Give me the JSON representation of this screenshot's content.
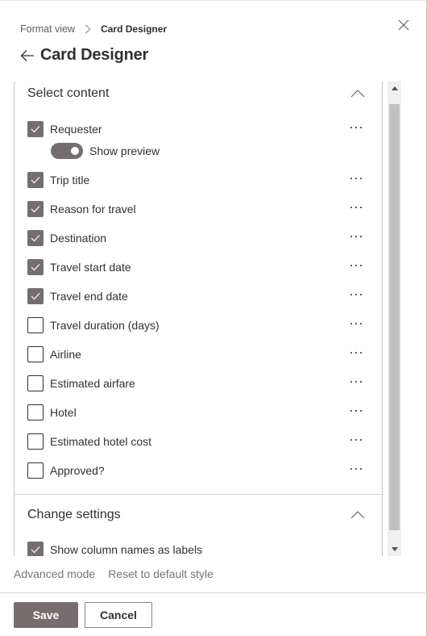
{
  "breadcrumb": {
    "parent": "Format view",
    "current": "Card Designer"
  },
  "header": {
    "title": "Card Designer",
    "back_icon": "arrow-left-icon",
    "close_icon": "close-icon"
  },
  "sections": {
    "select_content": {
      "title": "Select content",
      "expanded": true,
      "items": [
        {
          "label": "Requester",
          "checked": true
        },
        {
          "label": "Trip title",
          "checked": true
        },
        {
          "label": "Reason for travel",
          "checked": true
        },
        {
          "label": "Destination",
          "checked": true
        },
        {
          "label": "Travel start date",
          "checked": true
        },
        {
          "label": "Travel end date",
          "checked": true
        },
        {
          "label": "Travel duration (days)",
          "checked": false
        },
        {
          "label": "Airline",
          "checked": false
        },
        {
          "label": "Estimated airfare",
          "checked": false
        },
        {
          "label": "Hotel",
          "checked": false
        },
        {
          "label": "Estimated hotel cost",
          "checked": false
        },
        {
          "label": "Approved?",
          "checked": false
        }
      ],
      "preview_toggle": {
        "label": "Show preview",
        "on": true
      }
    },
    "change_settings": {
      "title": "Change settings",
      "expanded": true,
      "items": [
        {
          "label": "Show column names as labels",
          "checked": true
        }
      ]
    }
  },
  "footer": {
    "links": [
      "Advanced mode",
      "Reset to default style"
    ],
    "save_label": "Save",
    "cancel_label": "Cancel"
  },
  "colors": {
    "accent": "#766e6e",
    "text": "#323130",
    "muted_text": "#7a7574"
  }
}
